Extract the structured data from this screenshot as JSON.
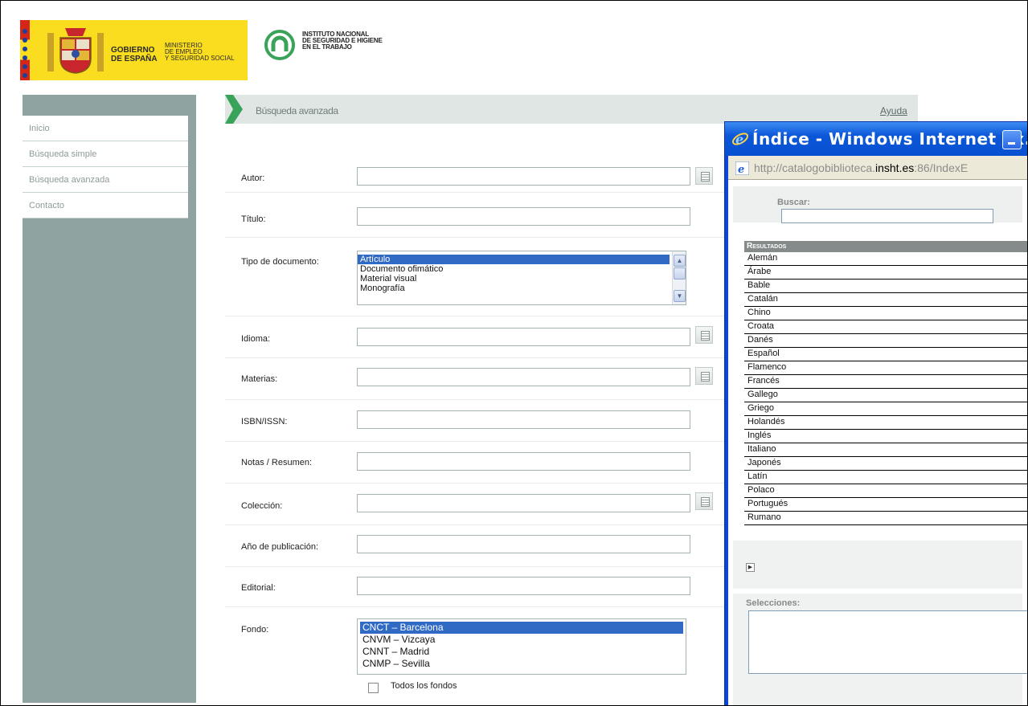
{
  "header": {
    "gov_line1": "GOBIERNO",
    "gov_line2": "DE ESPAÑA",
    "ministry_line1": "MINISTERIO",
    "ministry_line2": "DE EMPLEO",
    "ministry_line3": "Y SEGURIDAD SOCIAL",
    "insht_line1": "INSTITUTO NACIONAL",
    "insht_line2": "DE SEGURIDAD E HIGIENE",
    "insht_line3": "EN EL TRABAJO"
  },
  "sidebar": {
    "items": [
      {
        "label": "Inicio"
      },
      {
        "label": "Búsqueda simple"
      },
      {
        "label": "Búsqueda avanzada"
      },
      {
        "label": "Contacto"
      }
    ]
  },
  "main": {
    "title": "Búsqueda avanzada",
    "help": "Ayuda"
  },
  "form": {
    "autor": "Autor:",
    "titulo": "Título:",
    "tipo": "Tipo de documento:",
    "tipo_options": [
      "Artículo",
      "Documento ofimático",
      "Material visual",
      "Monografía"
    ],
    "tipo_selected": "Artículo",
    "idioma": "Idioma:",
    "materias": "Materias:",
    "isbn": "ISBN/ISSN:",
    "notas": "Notas / Resumen:",
    "coleccion": "Colección:",
    "anio": "Año de publicación:",
    "editorial": "Editorial:",
    "fondo": "Fondo:",
    "fondo_options": [
      "CNCT – Barcelona",
      "CNVM – Vizcaya",
      "CNNT – Madrid",
      "CNMP – Sevilla"
    ],
    "fondo_selected": "CNCT – Barcelona",
    "todos_fondos": "Todos los fondos"
  },
  "popup": {
    "title": "Índice - Windows Internet Ex...",
    "url_prefix": "http://catalogobiblioteca.",
    "url_host": "insht.es",
    "url_suffix": ":86/IndexE",
    "search_label": "Buscar:",
    "results_header": "Resultados",
    "results": [
      "Alemán",
      "Árabe",
      "Bable",
      "Catalán",
      "Chino",
      "Croata",
      "Danés",
      "Español",
      "Flamenco",
      "Francés",
      "Gallego",
      "Griego",
      "Holandés",
      "Inglés",
      "Italiano",
      "Japonés",
      "Latín",
      "Polaco",
      "Portugués",
      "Rumano"
    ],
    "selections_label": "Selecciones:"
  },
  "colors": {
    "sidebar": "#8fa4a1",
    "accent_green": "#3aa35a",
    "selection_blue": "#316ac5",
    "xp_title_blue": "#0b57d8",
    "gov_yellow": "#fbdd1f"
  }
}
